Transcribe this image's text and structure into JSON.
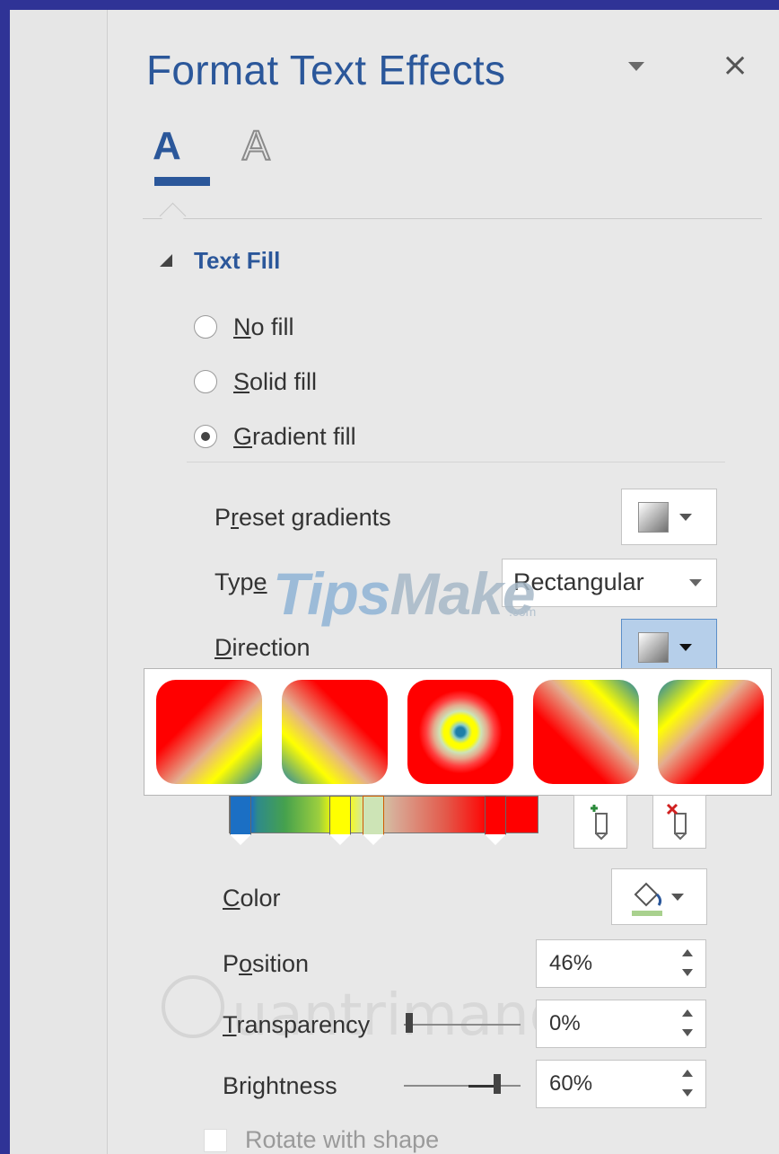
{
  "pane": {
    "title": "Format Text Effects",
    "tab_fill_label": "A",
    "tab_outline_label": "A"
  },
  "section": {
    "title": "Text Fill"
  },
  "fill_options": {
    "no_fill_first": "N",
    "no_fill_rest": "o fill",
    "solid_fill_first": "S",
    "solid_fill_rest": "olid fill",
    "gradient_fill_first": "G",
    "gradient_fill_rest": "radient fill",
    "selected": "Gradient fill"
  },
  "gradient": {
    "preset_label_a": "P",
    "preset_label_ul": "r",
    "preset_label_b": "eset gradients",
    "type_label_a": "Typ",
    "type_label_ul": "e",
    "type_value": "Rectangular",
    "direction_label_ul": "D",
    "direction_label_rest": "irection"
  },
  "watermark": {
    "brand_a": "Tips",
    "brand_b": "Make",
    "brand_suffix": ".com",
    "site2": "uantrimang"
  },
  "stops": {
    "color_label_ul": "C",
    "color_label_rest": "olor",
    "position_label_a": "P",
    "position_label_ul": "o",
    "position_label_b": "sition",
    "position_value": "46%",
    "transparency_label_ul": "T",
    "transparency_label_rest": "ransparency",
    "transparency_value": "0%",
    "brightness_label": "Brightness",
    "brightness_value": "60%",
    "brightness_level": 0.6,
    "transparency_level": 0.0
  },
  "rotate": {
    "label": "Rotate with shape"
  },
  "colors": {
    "accent": "#2b579a",
    "gradient_red": "#ff0000",
    "gradient_yellow": "#ffff00",
    "gradient_blue": "#1b6fc4"
  },
  "icons": {
    "close": "×",
    "add_stop": "add-gradient-stop-icon",
    "remove_stop": "remove-gradient-stop-icon",
    "paint_bucket": "paint-bucket-icon"
  }
}
